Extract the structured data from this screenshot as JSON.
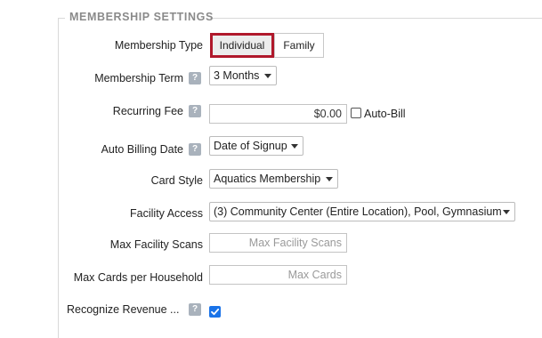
{
  "section": {
    "title": "MEMBERSHIP SETTINGS"
  },
  "membership_type": {
    "label": "Membership Type",
    "options": [
      "Individual",
      "Family"
    ],
    "selected": "Individual"
  },
  "membership_term": {
    "label": "Membership Term",
    "help": "?",
    "value": "3 Months"
  },
  "recurring_fee": {
    "label": "Recurring Fee",
    "help": "?",
    "value": "$0.00",
    "auto_bill_label": "Auto-Bill",
    "auto_bill_checked": false
  },
  "auto_billing_date": {
    "label": "Auto Billing Date",
    "help": "?",
    "value": "Date of Signup"
  },
  "card_style": {
    "label": "Card Style",
    "value": "Aquatics Membership"
  },
  "facility_access": {
    "label": "Facility Access",
    "value": "(3) Community Center (Entire Location), Pool, Gymnasium"
  },
  "max_facility_scans": {
    "label": "Max Facility Scans",
    "placeholder": "Max Facility Scans",
    "value": ""
  },
  "max_cards": {
    "label": "Max Cards per Household",
    "placeholder": "Max Cards",
    "value": ""
  },
  "recognize_revenue": {
    "label": "Recognize Revenue ...",
    "help": "?",
    "checked": true
  },
  "colors": {
    "accent_border": "#b0182b",
    "checkbox_blue": "#1a73e8",
    "help_bg": "#a9b2bc"
  }
}
